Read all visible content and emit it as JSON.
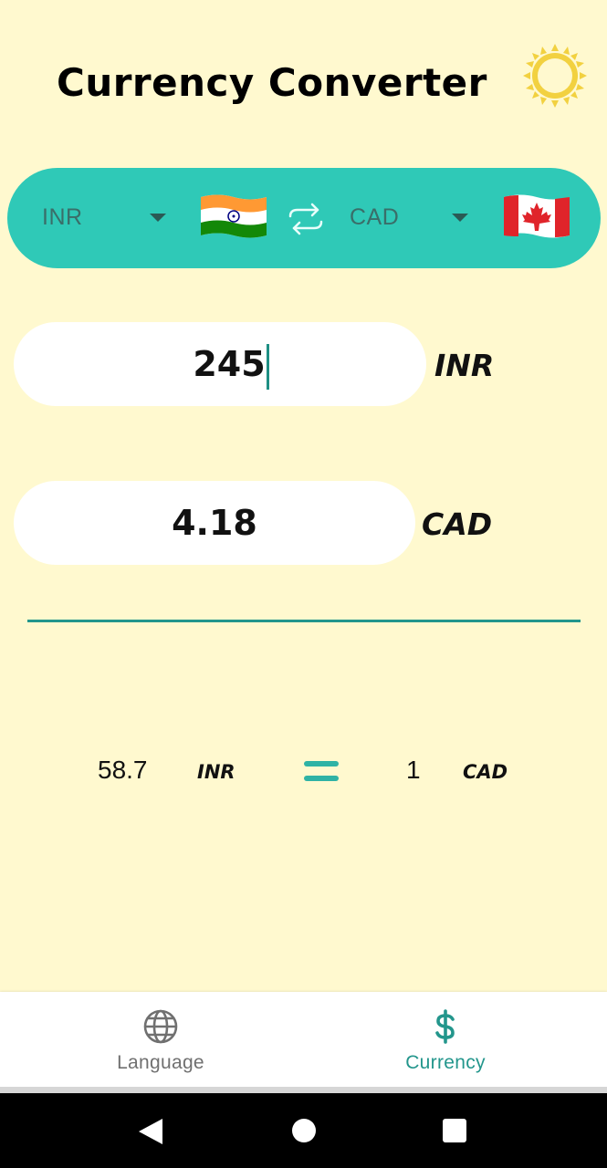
{
  "app": {
    "title": "Currency Converter",
    "settings_icon": "sun-icon"
  },
  "colors": {
    "background": "#fff9cf",
    "accent": "#2fc9b7",
    "accent_dark": "#23968c",
    "text": "#111111"
  },
  "picker": {
    "from_currency": "INR",
    "from_flag": "india-flag-icon",
    "swap_icon": "swap-arrows-icon",
    "to_currency": "CAD",
    "to_flag": "canada-flag-icon"
  },
  "input": {
    "value": "245",
    "code": "INR"
  },
  "output": {
    "value": "4.18",
    "code": "CAD"
  },
  "rate": {
    "from_amount": "58.7",
    "from_code": "INR",
    "equals_icon": "equals-icon",
    "to_amount": "1",
    "to_code": "CAD"
  },
  "bottom_nav": [
    {
      "label": "Language",
      "icon": "globe-icon",
      "active": false
    },
    {
      "label": "Currency",
      "icon": "dollar-icon",
      "active": true
    }
  ],
  "system_nav": {
    "back": "back-icon",
    "home": "home-icon",
    "recents": "recents-icon"
  }
}
